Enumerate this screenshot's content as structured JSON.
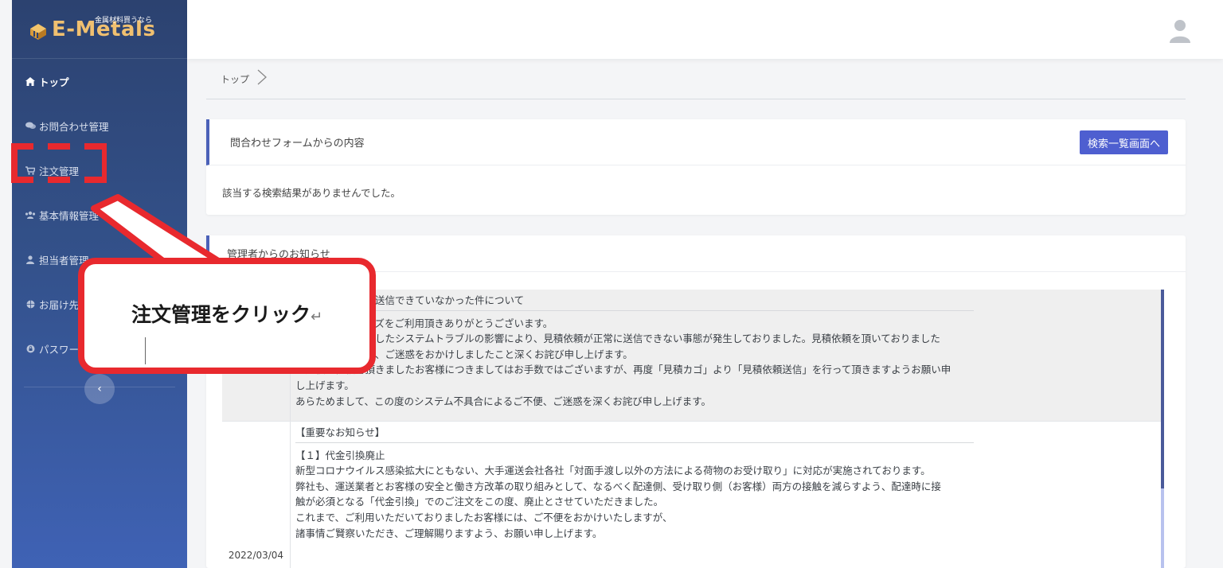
{
  "brand": {
    "logo_text": "E-Metals",
    "tagline": "金属材料買うなら"
  },
  "sidebar": {
    "items": [
      {
        "label": "トップ",
        "icon": "home-icon"
      },
      {
        "label": "お問合わせ管理",
        "icon": "chat-icon"
      },
      {
        "label": "注文管理",
        "icon": "cart-icon"
      },
      {
        "label": "基本情報管理",
        "icon": "users-icon"
      },
      {
        "label": "担当者管理",
        "icon": "user-icon"
      },
      {
        "label": "お届け先管理",
        "icon": "globe-icon"
      },
      {
        "label": "パスワード変更",
        "icon": "lock-icon"
      }
    ],
    "collapse_label": "‹"
  },
  "breadcrumb": {
    "items": [
      "トップ"
    ]
  },
  "inquiry_card": {
    "title": "問合わせフォームからの内容",
    "button_label": "検索一覧画面へ",
    "empty_message": "該当する検索結果がありませんでした。"
  },
  "notice_card": {
    "title": "管理者からのお知らせ",
    "rows": [
      {
        "date": "",
        "title": "見積依頼が正常に送信できていなかった件について",
        "lines": [
          "いつもイーメタルズをご利用頂きありがとうございます。",
          "この度、発生しましたシステムトラブルの影響により、見積依頼が正常に送信できない事態が発生しておりました。見積依頼を頂いておりました",
          "お客様にはご不便、ご迷惑をおかけしましたこと深くお詫び申し上げます。",
          "お見積り依頼を頂きましたお客様につきましてはお手数ではございますが、再度「見積カゴ」より「見積依頼送信」を行って頂きますようお願い申",
          "し上げます。",
          "あらためまして、この度のシステム不具合によるご不便、ご迷惑を深くお詫び申し上げます。"
        ]
      },
      {
        "date": "2022/03/04",
        "title": "【重要なお知らせ】",
        "lines": [
          "【１】代金引換廃止",
          "新型コロナウイルス感染拡大にともない、大手運送会社各社「対面手渡し以外の方法による荷物のお受け取り」に対応が実施されております。",
          "弊社も、運送業者とお客様の安全と働き方改革の取り組みとして、なるべく配達側、受け取り側（お客様）両方の接触を減らすよう、配達時に接",
          "触が必須となる「代金引換」でのご注文をこの度、廃止とさせていただきました。",
          "これまで、ご利用いただいておりましたお客様には、ご不便をおかけいたしますが、",
          "諸事情ご賢察いただき、ご理解賜りますよう、お願い申し上げます。"
        ]
      }
    ]
  },
  "annotation": {
    "callout_text": "注文管理をクリック",
    "return_mark": "↵",
    "color": "#e8292e"
  }
}
